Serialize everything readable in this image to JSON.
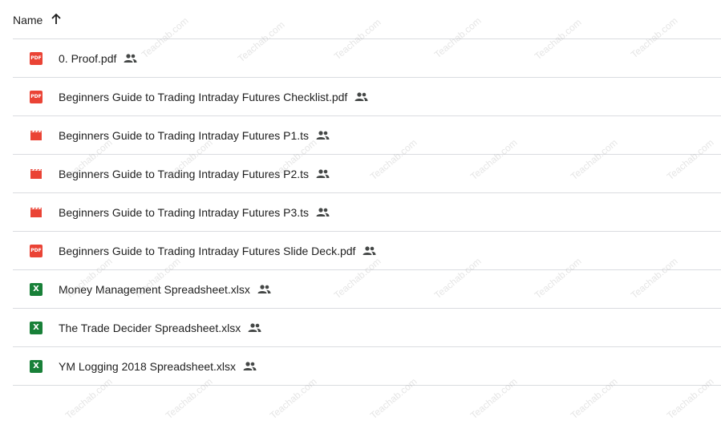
{
  "header": {
    "name_label": "Name",
    "sort_icon": "arrow-up-icon"
  },
  "files": [
    {
      "name": "0. Proof.pdf",
      "type": "pdf",
      "icon_text": "PDF",
      "shared": true
    },
    {
      "name": "Beginners Guide to Trading Intraday Futures Checklist.pdf",
      "type": "pdf",
      "icon_text": "PDF",
      "shared": true
    },
    {
      "name": "Beginners Guide to Trading Intraday Futures P1.ts",
      "type": "video",
      "shared": true
    },
    {
      "name": "Beginners Guide to Trading Intraday Futures P2.ts",
      "type": "video",
      "shared": true
    },
    {
      "name": "Beginners Guide to Trading Intraday Futures P3.ts",
      "type": "video",
      "shared": true
    },
    {
      "name": "Beginners Guide to Trading Intraday Futures Slide Deck.pdf",
      "type": "pdf",
      "icon_text": "PDF",
      "shared": true
    },
    {
      "name": "Money Management Spreadsheet.xlsx",
      "type": "xlsx",
      "icon_text": "X",
      "shared": true
    },
    {
      "name": "The Trade Decider Spreadsheet.xlsx",
      "type": "xlsx",
      "icon_text": "X",
      "shared": true
    },
    {
      "name": "YM Logging 2018 Spreadsheet.xlsx",
      "type": "xlsx",
      "icon_text": "X",
      "shared": true
    }
  ],
  "watermark": "Teachab.com",
  "colors": {
    "pdf": "#ea4335",
    "video": "#ea4335",
    "xlsx": "#188038",
    "divider": "#dadce0",
    "text": "#1f1f1f",
    "shared_icon": "#444746"
  }
}
